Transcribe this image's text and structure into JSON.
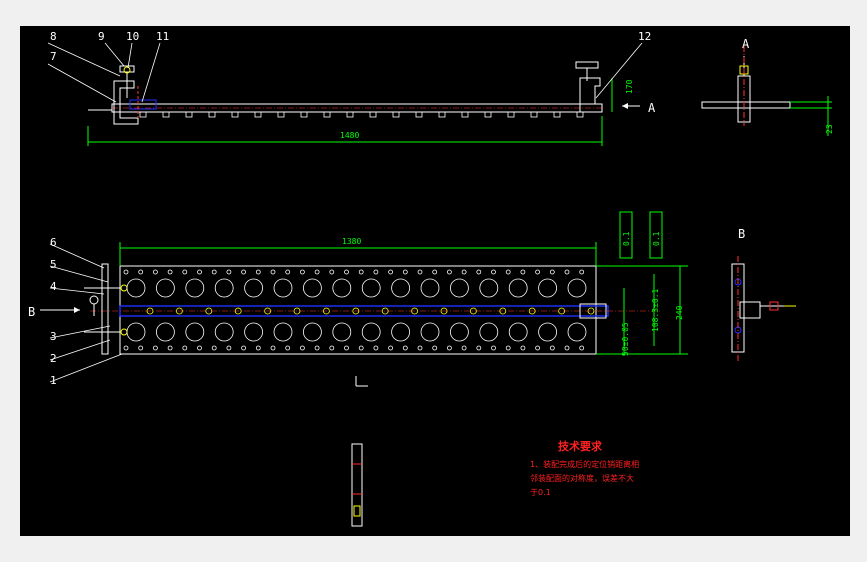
{
  "colors": {
    "background": "#000000",
    "outline": "#ffffff",
    "dimension": "#00ff00",
    "axis": "#ff3030",
    "accent": "#2030ff",
    "note": "#ff2020",
    "part": "#ffff00"
  },
  "top_view": {
    "part_numbers": [
      "8",
      "9",
      "10",
      "7",
      "11",
      "12"
    ],
    "dims": {
      "length": "1480",
      "height": "170"
    },
    "view_arrow": "A"
  },
  "side_view_a": {
    "title": "A",
    "dim": "23"
  },
  "front_view": {
    "part_numbers": [
      "6",
      "5",
      "4",
      "3",
      "2",
      "1"
    ],
    "dims": {
      "length": "1380",
      "width": "240",
      "hole_pitch": "108.3±0.1",
      "spacing": "50±0.05"
    },
    "tolerance_frames": [
      "0.1",
      "0.1"
    ],
    "view_arrow": "B"
  },
  "side_view_b": {
    "title": "B"
  },
  "notes": {
    "title": "技术要求",
    "lines": [
      "1、装配完成后的定位销距离相",
      "邻装配面的对称度，误差不大",
      "于0.1"
    ]
  }
}
